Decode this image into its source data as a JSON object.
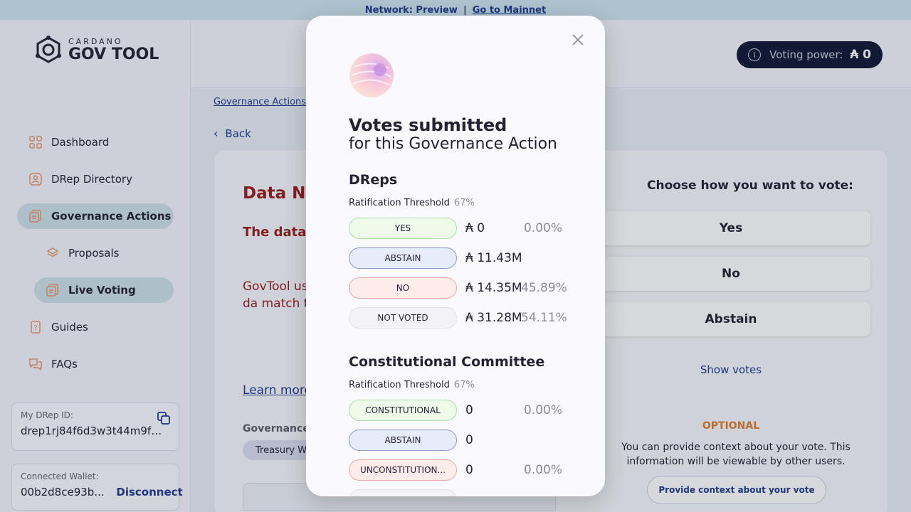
{
  "banner": {
    "network": "Network: Preview",
    "separator": "|",
    "mainnet_link": "Go to Mainnet"
  },
  "logo": {
    "small": "CARDANO",
    "big": "GOV TOOL"
  },
  "sidebar": {
    "items": [
      {
        "label": "Dashboard",
        "icon": "dashboard-icon"
      },
      {
        "label": "DRep Directory",
        "icon": "drep-directory-icon"
      },
      {
        "label": "Governance Actions",
        "icon": "governance-actions-icon"
      },
      {
        "label": "Proposals",
        "icon": "proposals-icon"
      },
      {
        "label": "Live Voting",
        "icon": "live-voting-icon"
      },
      {
        "label": "Guides",
        "icon": "guides-icon"
      },
      {
        "label": "FAQs",
        "icon": "faqs-icon"
      }
    ],
    "drep_id": {
      "label": "My DRep ID:",
      "value": "drep1rj84f6d3w3t44m9fm..."
    },
    "wallet": {
      "label": "Connected Wallet:",
      "value": "00b2d8ce93b...",
      "disconnect": "Disconnect"
    }
  },
  "header": {
    "voting_power_label": "Voting power:",
    "voting_power_value": "₳ 0"
  },
  "breadcrumb": {
    "root": "Governance Actions"
  },
  "back_label": "Back",
  "main": {
    "title": "Data No",
    "bold_text": "The data t this Gover changed.",
    "body_text": "GovTool use Action data the propos that the da match the was origina",
    "learn_more": "Learn more",
    "gat_label": "Governance",
    "chip": "Treasury Wi"
  },
  "vote_panel": {
    "title": "Choose how you want to vote:",
    "options": [
      "Yes",
      "No",
      "Abstain"
    ],
    "show_votes": "Show votes",
    "optional": "OPTIONAL",
    "context_text": "You can provide context about your vote. This information will be viewable by other users.",
    "context_button": "Provide context about your vote"
  },
  "modal": {
    "title": "Votes submitted",
    "subtitle": "for this Governance Action",
    "dreps": {
      "title": "DReps",
      "threshold_label": "Ratification Threshold",
      "threshold_value": "67%",
      "rows": [
        {
          "label": "YES",
          "amount": "₳ 0",
          "percent": "0.00%"
        },
        {
          "label": "ABSTAIN",
          "amount": "₳ 11.43M",
          "percent": ""
        },
        {
          "label": "NO",
          "amount": "₳ 14.35M",
          "percent": "45.89%"
        },
        {
          "label": "NOT VOTED",
          "amount": "₳ 31.28M",
          "percent": "54.11%"
        }
      ]
    },
    "committee": {
      "title": "Constitutional Committee",
      "threshold_label": "Ratification Threshold",
      "threshold_value": "67%",
      "rows": [
        {
          "label": "CONSTITUTIONAL",
          "amount": "0",
          "percent": "0.00%"
        },
        {
          "label": "ABSTAIN",
          "amount": "0",
          "percent": ""
        },
        {
          "label": "UNCONSTITUTION...",
          "amount": "0",
          "percent": "0.00%"
        }
      ]
    }
  }
}
